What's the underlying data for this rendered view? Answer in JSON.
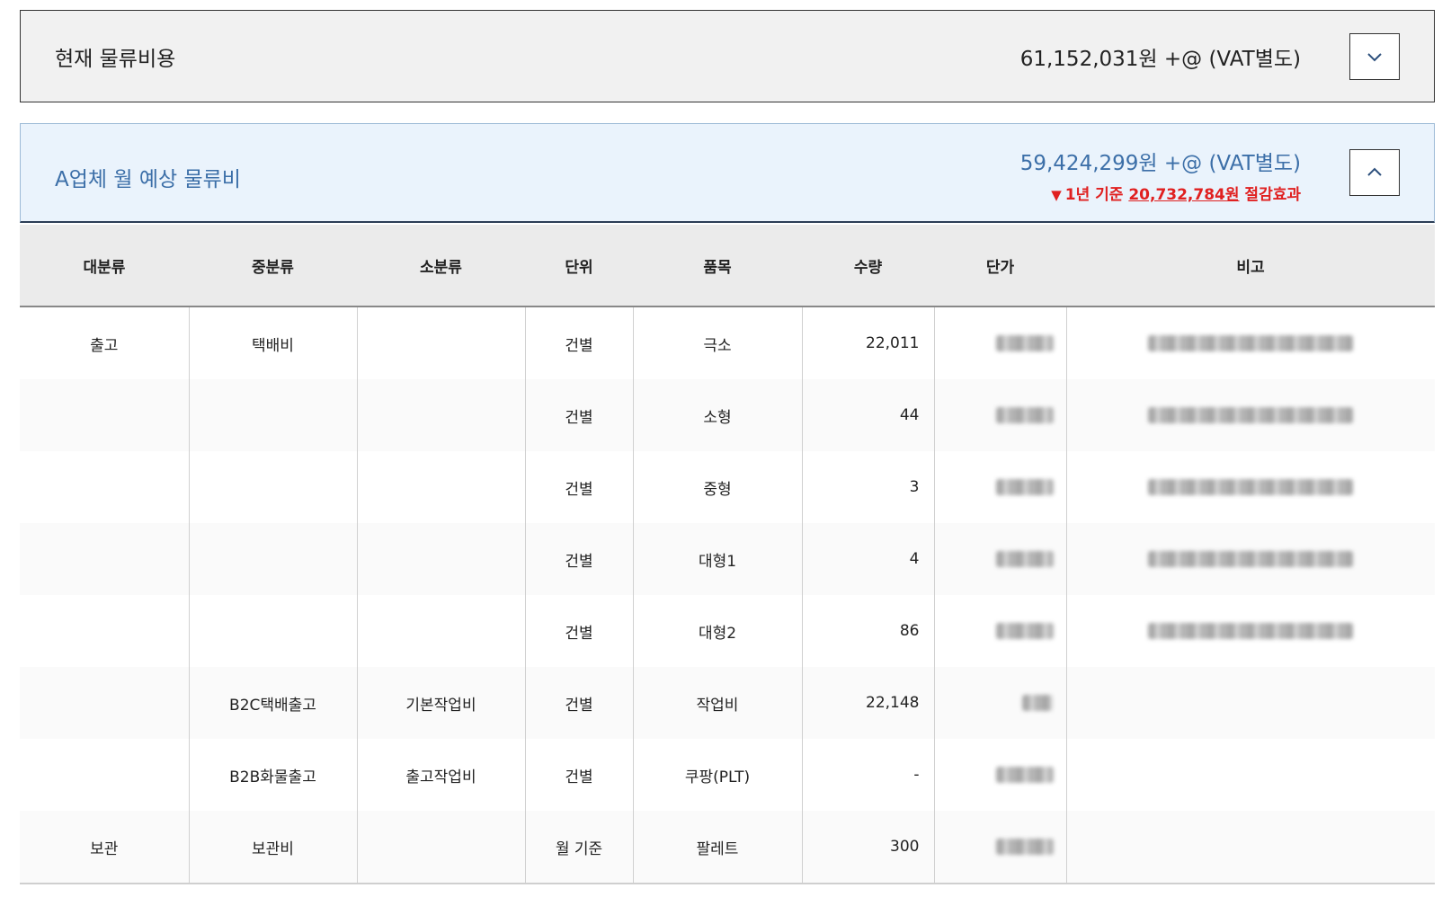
{
  "current": {
    "title": "현재 물류비용",
    "amount": "61,152,031원 +@ (VAT별도)",
    "toggle_icon": "chevron-down-icon"
  },
  "expected": {
    "title": "A업체 월 예상 물류비",
    "amount": "59,424,299원 +@ (VAT별도)",
    "savings_prefix": "1년 기준 ",
    "savings_amount": "20,732,784원",
    "savings_suffix": " 절감효과",
    "savings_icon": "triangle-down-icon",
    "toggle_icon": "chevron-up-icon",
    "colors": {
      "accent": "#3c6fa8",
      "savings": "#e02020",
      "panel_bg": "#eaf3fc"
    }
  },
  "table": {
    "headers": [
      "대분류",
      "중분류",
      "소분류",
      "단위",
      "품목",
      "수량",
      "단가",
      "비고"
    ],
    "rows": [
      {
        "major": "출고",
        "middle": "택배비",
        "minor": "",
        "unit": "건별",
        "item": "극소",
        "qty": "22,011"
      },
      {
        "major": "",
        "middle": "",
        "minor": "",
        "unit": "건별",
        "item": "소형",
        "qty": "44"
      },
      {
        "major": "",
        "middle": "",
        "minor": "",
        "unit": "건별",
        "item": "중형",
        "qty": "3"
      },
      {
        "major": "",
        "middle": "",
        "minor": "",
        "unit": "건별",
        "item": "대형1",
        "qty": "4"
      },
      {
        "major": "",
        "middle": "",
        "minor": "",
        "unit": "건별",
        "item": "대형2",
        "qty": "86"
      },
      {
        "major": "",
        "middle": "B2C택배출고",
        "minor": "기본작업비",
        "unit": "건별",
        "item": "작업비",
        "qty": "22,148"
      },
      {
        "major": "",
        "middle": "B2B화물출고",
        "minor": "출고작업비",
        "unit": "건별",
        "item": "쿠팡(PLT)",
        "qty": "-"
      },
      {
        "major": "보관",
        "middle": "보관비",
        "minor": "",
        "unit": "월 기준",
        "item": "팔레트",
        "qty": "300"
      }
    ]
  }
}
